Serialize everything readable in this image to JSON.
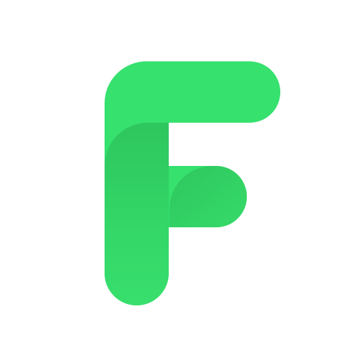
{
  "logo": {
    "icon": "letter-f-logo-icon",
    "colors": {
      "primary": "#36E16E",
      "mid": "#31D064",
      "shade": "#2DC45D",
      "background": "#FFFFFF"
    }
  }
}
